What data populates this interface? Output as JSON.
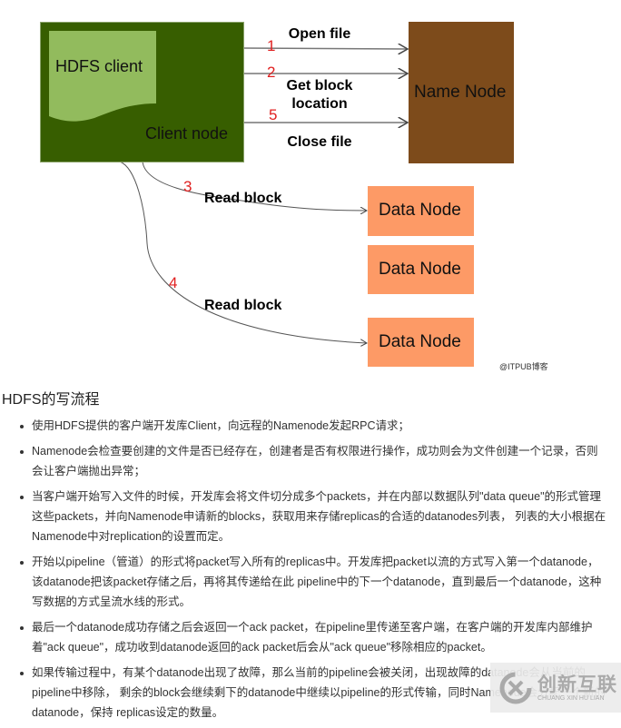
{
  "diagram": {
    "client_node": {
      "label": "Client node",
      "color": "#375e00"
    },
    "hdfs_client": {
      "label": "HDFS client",
      "color": "#92bb5d"
    },
    "name_node": {
      "label": "Name Node",
      "color": "#7d4b1b"
    },
    "data_nodes": [
      {
        "label": "Data Node"
      },
      {
        "label": "Data Node"
      },
      {
        "label": "Data Node"
      }
    ],
    "data_node_color": "#fd9a66",
    "steps": [
      {
        "num": "1",
        "label": "Open file"
      },
      {
        "num": "2",
        "label": "Get block location"
      },
      {
        "num": "5",
        "label": "Close file"
      },
      {
        "num": "3",
        "label": "Read block"
      },
      {
        "num": "4",
        "label": "Read block"
      }
    ],
    "credit": "@ITPUB博客"
  },
  "article": {
    "heading": "HDFS的写流程",
    "items": [
      "使用HDFS提供的客户端开发库Client，向远程的Namenode发起RPC请求；",
      "Namenode会检查要创建的文件是否已经存在，创建者是否有权限进行操作，成功则会为文件创建一个记录，否则会让客户端抛出异常；",
      "当客户端开始写入文件的时候，开发库会将文件切分成多个packets，并在内部以数据队列\"data queue\"的形式管理这些packets，并向Namenode申请新的blocks，获取用来存储replicas的合适的datanodes列表， 列表的大小根据在Namenode中对replication的设置而定。",
      "开始以pipeline（管道）的形式将packet写入所有的replicas中。开发库把packet以流的方式写入第一个datanode，该datanode把该packet存储之后，再将其传递给在此 pipeline中的下一个datanode，直到最后一个datanode，这种写数据的方式呈流水线的形式。",
      "最后一个datanode成功存储之后会返回一个ack packet，在pipeline里传递至客户端，在客户端的开发库内部维护着\"ack queue\"，成功收到datanode返回的ack packet后会从\"ack queue\"移除相应的packet。",
      "如果传输过程中，有某个datanode出现了故障，那么当前的pipeline会被关闭，出现故障的datanode会从当前的pipeline中移除， 剩余的block会继续剩下的datanode中继续以pipeline的形式传输，同时Namenode会分配一个新的datanode，保持 replicas设定的数量。"
    ]
  },
  "watermark": {
    "name": "创新互联",
    "pinyin": "CHUANG XIN HU LIAN"
  }
}
